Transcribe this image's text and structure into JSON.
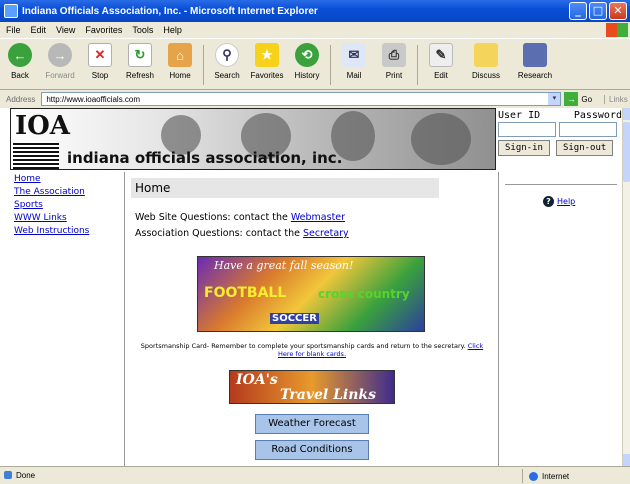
{
  "window": {
    "title": "Indiana Officials Association, Inc. - Microsoft Internet Explorer"
  },
  "menu": [
    "File",
    "Edit",
    "View",
    "Favorites",
    "Tools",
    "Help"
  ],
  "toolbar": {
    "back": "Back",
    "forward": "Forward",
    "stop": "Stop",
    "refresh": "Refresh",
    "home": "Home",
    "search": "Search",
    "favorites": "Favorites",
    "history": "History",
    "mail": "Mail",
    "print": "Print",
    "edit": "Edit",
    "discuss": "Discuss",
    "research": "Research"
  },
  "address": {
    "label": "Address",
    "url": "http://www.ioaofficials.com",
    "go": "Go",
    "links": "Links"
  },
  "banner": {
    "logo": "IOA",
    "org_name": "indiana officials association, inc."
  },
  "login": {
    "user_id_label": "User ID",
    "password_label": "Password",
    "signin": "Sign-in",
    "signout": "Sign-out"
  },
  "nav": [
    "Home",
    "The Association",
    "Sports",
    "WWW Links",
    "Web Instructions"
  ],
  "main": {
    "heading": "Home",
    "web_q_prefix": "Web Site Questions: contact the ",
    "web_q_link": "Webmaster",
    "assoc_q_prefix": "Association Questions: contact the ",
    "assoc_q_link": "Secretary",
    "fall_banner": {
      "line1": "Have a great fall season!",
      "football": "FOOTBALL",
      "xc": "cross country",
      "soccer": "SOCCER"
    },
    "sportsmanship_text": "Sportsmanship Card- Remember to complete your sportsmanship cards and return to the secretary.",
    "sportsmanship_link": "Click Here for blank cards.",
    "travel_banner": {
      "line1": "IOA's",
      "line2": "Travel Links"
    },
    "buttons": [
      "Weather Forecast",
      "Road Conditions"
    ]
  },
  "right": {
    "help": "Help"
  },
  "status": {
    "left": "Done",
    "zone": "Internet"
  }
}
